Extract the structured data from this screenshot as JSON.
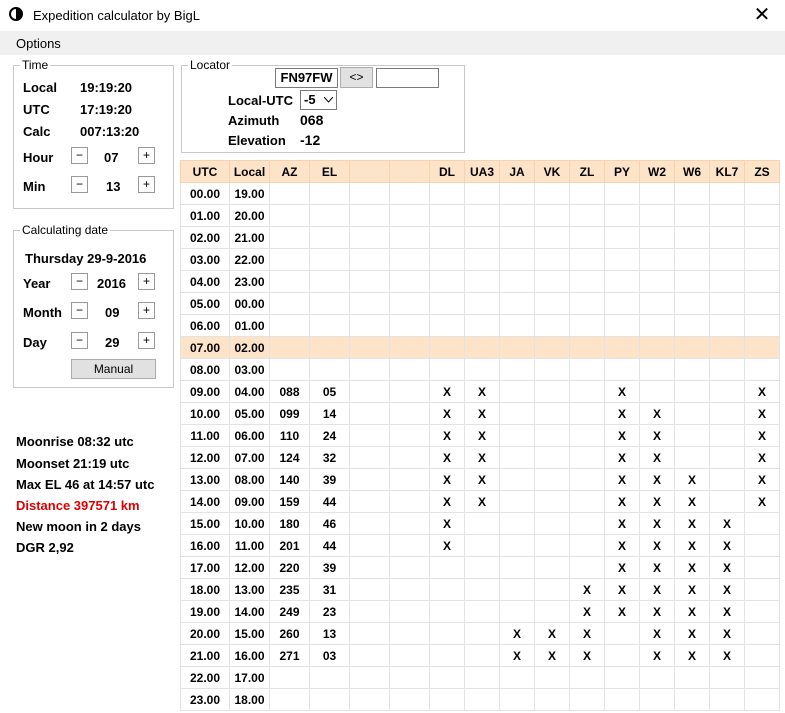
{
  "window": {
    "title": "Expedition calculator by BigL",
    "close_glyph": "✕"
  },
  "menu": {
    "options_label": "Options"
  },
  "time": {
    "legend": "Time",
    "local_label": "Local",
    "local_value": "19:19:20",
    "utc_label": "UTC",
    "utc_value": "17:19:20",
    "calc_label": "Calc",
    "calc_value": "007:13:20",
    "hour_label": "Hour",
    "hour_value": "07",
    "min_label": "Min",
    "min_value": "13",
    "minus": "−",
    "plus": "+"
  },
  "calc_date": {
    "legend": "Calculating date",
    "date_text": "Thursday 29-9-2016",
    "year_label": "Year",
    "year_value": "2016",
    "month_label": "Month",
    "month_value": "09",
    "day_label": "Day",
    "day_value": "29",
    "minus": "−",
    "plus": "+",
    "manual_label": "Manual"
  },
  "locator": {
    "legend": "Locator",
    "locator_value": "FN97FW",
    "swap_label": "<>",
    "second_value": "",
    "local_utc_label": "Local-UTC",
    "local_utc_value": "-5",
    "azimuth_label": "Azimuth",
    "azimuth_value": "068",
    "elevation_label": "Elevation",
    "elevation_value": "-12"
  },
  "moon_info": {
    "moonrise": "Moonrise 08:32 utc",
    "moonset": "Moonset 21:19 utc",
    "max_el": "Max EL 46 at 14:57 utc",
    "distance": "Distance 397571 km",
    "new_moon": "New moon in 2 days",
    "dgr": "DGR 2,92"
  },
  "colors": {
    "header_bg": "#fde3c7",
    "distance_red": "#e00000"
  },
  "table": {
    "headers": [
      "UTC",
      "Local",
      "AZ",
      "EL",
      "",
      "",
      "DL",
      "UA3",
      "JA",
      "VK",
      "ZL",
      "PY",
      "W2",
      "W6",
      "KL7",
      "ZS"
    ],
    "highlight_row": 7,
    "rows": [
      [
        "00.00",
        "19.00",
        "",
        "",
        "",
        "",
        "",
        "",
        "",
        "",
        "",
        "",
        "",
        "",
        "",
        ""
      ],
      [
        "01.00",
        "20.00",
        "",
        "",
        "",
        "",
        "",
        "",
        "",
        "",
        "",
        "",
        "",
        "",
        "",
        ""
      ],
      [
        "02.00",
        "21.00",
        "",
        "",
        "",
        "",
        "",
        "",
        "",
        "",
        "",
        "",
        "",
        "",
        "",
        ""
      ],
      [
        "03.00",
        "22.00",
        "",
        "",
        "",
        "",
        "",
        "",
        "",
        "",
        "",
        "",
        "",
        "",
        "",
        ""
      ],
      [
        "04.00",
        "23.00",
        "",
        "",
        "",
        "",
        "",
        "",
        "",
        "",
        "",
        "",
        "",
        "",
        "",
        ""
      ],
      [
        "05.00",
        "00.00",
        "",
        "",
        "",
        "",
        "",
        "",
        "",
        "",
        "",
        "",
        "",
        "",
        "",
        ""
      ],
      [
        "06.00",
        "01.00",
        "",
        "",
        "",
        "",
        "",
        "",
        "",
        "",
        "",
        "",
        "",
        "",
        "",
        ""
      ],
      [
        "07.00",
        "02.00",
        "",
        "",
        "",
        "",
        "",
        "",
        "",
        "",
        "",
        "",
        "",
        "",
        "",
        ""
      ],
      [
        "08.00",
        "03.00",
        "",
        "",
        "",
        "",
        "",
        "",
        "",
        "",
        "",
        "",
        "",
        "",
        "",
        ""
      ],
      [
        "09.00",
        "04.00",
        "088",
        "05",
        "",
        "",
        "X",
        "X",
        "",
        "",
        "",
        "X",
        "",
        "",
        "",
        "X"
      ],
      [
        "10.00",
        "05.00",
        "099",
        "14",
        "",
        "",
        "X",
        "X",
        "",
        "",
        "",
        "X",
        "X",
        "",
        "",
        "X"
      ],
      [
        "11.00",
        "06.00",
        "110",
        "24",
        "",
        "",
        "X",
        "X",
        "",
        "",
        "",
        "X",
        "X",
        "",
        "",
        "X"
      ],
      [
        "12.00",
        "07.00",
        "124",
        "32",
        "",
        "",
        "X",
        "X",
        "",
        "",
        "",
        "X",
        "X",
        "",
        "",
        "X"
      ],
      [
        "13.00",
        "08.00",
        "140",
        "39",
        "",
        "",
        "X",
        "X",
        "",
        "",
        "",
        "X",
        "X",
        "X",
        "",
        "X"
      ],
      [
        "14.00",
        "09.00",
        "159",
        "44",
        "",
        "",
        "X",
        "X",
        "",
        "",
        "",
        "X",
        "X",
        "X",
        "",
        "X"
      ],
      [
        "15.00",
        "10.00",
        "180",
        "46",
        "",
        "",
        "X",
        "",
        "",
        "",
        "",
        "X",
        "X",
        "X",
        "X",
        ""
      ],
      [
        "16.00",
        "11.00",
        "201",
        "44",
        "",
        "",
        "X",
        "",
        "",
        "",
        "",
        "X",
        "X",
        "X",
        "X",
        ""
      ],
      [
        "17.00",
        "12.00",
        "220",
        "39",
        "",
        "",
        "",
        "",
        "",
        "",
        "",
        "X",
        "X",
        "X",
        "X",
        ""
      ],
      [
        "18.00",
        "13.00",
        "235",
        "31",
        "",
        "",
        "",
        "",
        "",
        "",
        "X",
        "X",
        "X",
        "X",
        "X",
        ""
      ],
      [
        "19.00",
        "14.00",
        "249",
        "23",
        "",
        "",
        "",
        "",
        "",
        "",
        "X",
        "X",
        "X",
        "X",
        "X",
        ""
      ],
      [
        "20.00",
        "15.00",
        "260",
        "13",
        "",
        "",
        "",
        "",
        "X",
        "X",
        "X",
        "",
        "X",
        "X",
        "X",
        ""
      ],
      [
        "21.00",
        "16.00",
        "271",
        "03",
        "",
        "",
        "",
        "",
        "X",
        "X",
        "X",
        "",
        "X",
        "X",
        "X",
        ""
      ],
      [
        "22.00",
        "17.00",
        "",
        "",
        "",
        "",
        "",
        "",
        "",
        "",
        "",
        "",
        "",
        "",
        "",
        ""
      ],
      [
        "23.00",
        "18.00",
        "",
        "",
        "",
        "",
        "",
        "",
        "",
        "",
        "",
        "",
        "",
        "",
        "",
        ""
      ]
    ]
  }
}
